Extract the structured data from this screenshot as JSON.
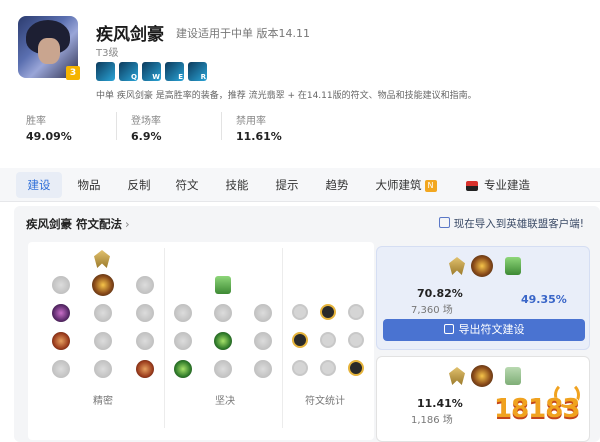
{
  "champion": {
    "name": "疾风剑豪",
    "subtitle": "建设适用于中单 版本14.11",
    "tier": "T3级",
    "tier_badge": "3",
    "skills": [
      {
        "key": "",
        "icon": "passive-icon"
      },
      {
        "key": "Q",
        "icon": "q-skill-icon"
      },
      {
        "key": "W",
        "icon": "w-skill-icon"
      },
      {
        "key": "E",
        "icon": "e-skill-icon"
      },
      {
        "key": "R",
        "icon": "r-skill-icon"
      }
    ],
    "description": "中单 疾风剑豪 是高胜率的装备，推荐 流光翡翠 + 在14.11版的符文、物品和技能建议和指南。"
  },
  "stats": [
    {
      "label": "胜率",
      "value": "49.09%"
    },
    {
      "label": "登场率",
      "value": "6.9%"
    },
    {
      "label": "禁用率",
      "value": "11.61%"
    }
  ],
  "tabs": [
    {
      "label": "建设",
      "active": true
    },
    {
      "label": "物品"
    },
    {
      "label": "反制"
    },
    {
      "label": "符文"
    },
    {
      "label": "技能"
    },
    {
      "label": "提示"
    },
    {
      "label": "趋势"
    },
    {
      "label": "大师建筑",
      "badge": "N"
    },
    {
      "label": "专业建造",
      "brand": true
    }
  ],
  "runes_panel": {
    "title": "疾风剑豪 符文配法",
    "chevron": "›",
    "import_text": "现在导入到英雄联盟客户端!",
    "columns": [
      "精密",
      "坚决",
      "符文统计"
    ]
  },
  "builds": [
    {
      "win_rate": "70.82%",
      "games": "7,360 场",
      "pick_rate": "49.35%",
      "button": "导出符文建设"
    },
    {
      "win_rate": "11.41%",
      "games": "1,186 场"
    }
  ],
  "watermark": "18183",
  "colors": {
    "accent": "#4a73d1",
    "tab_active": "#2f6fd8",
    "tier_badge": "#f5b400"
  }
}
